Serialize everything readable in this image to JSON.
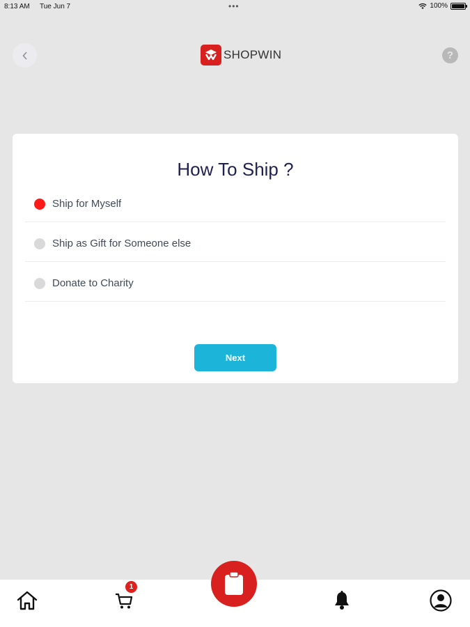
{
  "status_bar": {
    "time": "8:13 AM",
    "date": "Tue Jun 7",
    "dots": "•••",
    "battery": "100%",
    "battery_level": 1.0
  },
  "header": {
    "logo_text": "SHOPWIN",
    "help_symbol": "?",
    "back_icon": "chevron-left-icon"
  },
  "card": {
    "title": "How To Ship ?",
    "options": [
      {
        "label": "Ship for Myself",
        "selected": true
      },
      {
        "label": "Ship as Gift for Someone else",
        "selected": false
      },
      {
        "label": "Donate to Charity",
        "selected": false
      }
    ],
    "next_label": "Next"
  },
  "tab_bar": {
    "items": [
      "home-icon",
      "cart-icon",
      "clipboard-icon",
      "bell-icon",
      "profile-icon"
    ],
    "cart_badge": "1"
  },
  "colors": {
    "accent_red": "#d8211f",
    "selected_radio": "#ff1a1a",
    "next_button": "#1cb4d9",
    "title": "#1f2150",
    "background": "#e6e6e6"
  }
}
